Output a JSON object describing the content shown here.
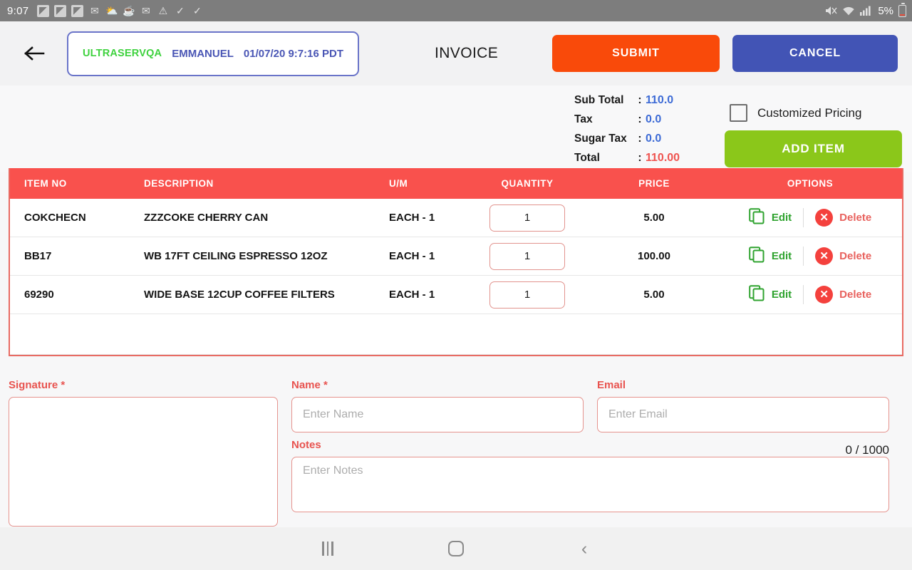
{
  "statusbar": {
    "time": "9:07",
    "left_icons": [
      "app-icon",
      "app-icon",
      "app-icon",
      "gmail-icon",
      "weather-icon",
      "coffee-icon",
      "mail-icon",
      "warning-icon",
      "check-icon",
      "check-icon"
    ],
    "right_icons": [
      "mute-icon",
      "wifi-icon",
      "signal-icon"
    ],
    "battery_percent": "5%"
  },
  "header": {
    "back_icon": "arrow-left-icon",
    "session": {
      "company": "ULTRASERVQA",
      "user": "EMMANUEL",
      "datetime": "01/07/20 9:7:16 PDT"
    },
    "title": "INVOICE",
    "submit_label": "SUBMIT",
    "cancel_label": "CANCEL",
    "submit_color": "#f94a0a",
    "cancel_color": "#4254b5"
  },
  "summary": {
    "sub_total_label": "Sub Total",
    "sub_total_value": "110.0",
    "tax_label": "Tax",
    "tax_value": "0.0",
    "sugar_tax_label": "Sugar Tax",
    "sugar_tax_value": "0.0",
    "total_label": "Total",
    "total_value": "110.00",
    "colon": ":",
    "value_color": "#3d6bd6",
    "total_color": "#ef5450",
    "customized_pricing_label": "Customized Pricing",
    "customized_pricing_checked": false,
    "add_item_label": "ADD ITEM",
    "add_item_color": "#8bc71a"
  },
  "table": {
    "header_color": "#f9514d",
    "columns": [
      "ITEM NO",
      "DESCRIPTION",
      "U/M",
      "QUANTITY",
      "PRICE",
      "OPTIONS"
    ],
    "edit_label": "Edit",
    "delete_label": "Delete",
    "rows": [
      {
        "item_no": "COKCHECN",
        "description": "ZZZCOKE CHERRY CAN",
        "um": "EACH - 1",
        "quantity": "1",
        "price": "5.00"
      },
      {
        "item_no": "BB17",
        "description": "WB 17FT CEILING ESPRESSO 12OZ",
        "um": "EACH - 1",
        "quantity": "1",
        "price": "100.00"
      },
      {
        "item_no": "69290",
        "description": "WIDE BASE 12CUP COFFEE FILTERS",
        "um": "EACH - 1",
        "quantity": "1",
        "price": "5.00"
      }
    ]
  },
  "form": {
    "signature_label": "Signature *",
    "signature_value": "",
    "name_label": "Name *",
    "name_placeholder": "Enter Name",
    "name_value": "",
    "email_label": "Email",
    "email_placeholder": "Enter Email",
    "email_value": "",
    "notes_label": "Notes",
    "notes_placeholder": "Enter Notes",
    "notes_value": "",
    "notes_counter": "0 / 1000",
    "label_color": "#e8534f"
  },
  "navbar": {
    "recents_label": "recents-icon",
    "home_label": "home-icon",
    "back_label": "back-icon"
  }
}
